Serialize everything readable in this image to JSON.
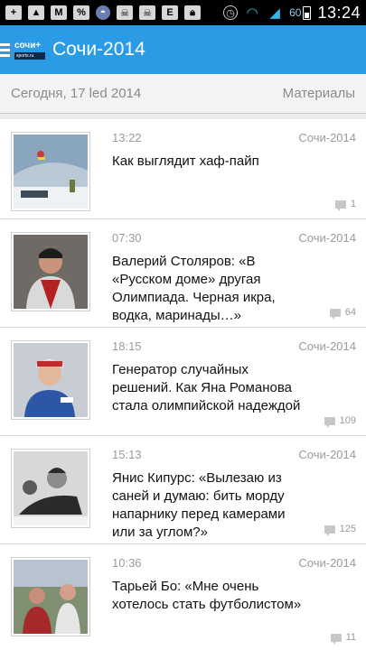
{
  "status": {
    "battery_percent": "60",
    "time": "13:24",
    "left_icons": [
      "add-icon",
      "image-icon",
      "gmail-icon",
      "discount-icon",
      "android-icon",
      "skull-icon",
      "skull-icon",
      "evernote-icon",
      "lock-icon"
    ],
    "right_icons": [
      "alarm-icon",
      "wifi-icon",
      "signal-icon",
      "battery-icon"
    ]
  },
  "appbar": {
    "logo_text": "сочи+",
    "logo_subtext": "sports.ru",
    "title": "Сочи-2014"
  },
  "subheader": {
    "date": "Сегодня, 17 led 2014",
    "materials_label": "Материалы"
  },
  "articles": [
    {
      "time": "13:22",
      "source": "Сочи-2014",
      "title": "Как выглядит хаф-пайп",
      "comments": "1"
    },
    {
      "time": "07:30",
      "source": "Сочи-2014",
      "title": "Валерий Столяров: «В «Русском доме» другая Олимпиада. Черная икра, водка, маринады…»",
      "comments": "64"
    },
    {
      "time": "18:15",
      "source": "Сочи-2014",
      "title": "Генератор случайных решений. Как Яна Романова стала олимпийской надеждой",
      "comments": "109"
    },
    {
      "time": "15:13",
      "source": "Сочи-2014",
      "title": "Янис Кипурс: «Вылезаю из саней и думаю: бить морду напарнику перед камерами или за углом?»",
      "comments": "125"
    },
    {
      "time": "10:36",
      "source": "Сочи-2014",
      "title": "Тарьей Бо: «Мне очень хотелось стать футболистом»",
      "comments": "11"
    }
  ]
}
